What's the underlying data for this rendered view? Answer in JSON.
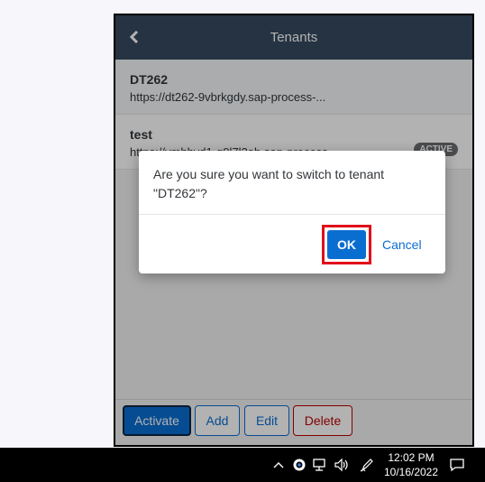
{
  "app": {
    "title": "Tenants",
    "back_icon": "chevron-left-icon"
  },
  "tenants": [
    {
      "name": "DT262",
      "url": "https://dt262-9vbrkgdy.sap-process-...",
      "badge": ""
    },
    {
      "name": "test",
      "url": "https://vmhhvd1-g9l7l3ab.sap-process-...",
      "badge": "ACTIVE"
    }
  ],
  "footer": {
    "activate_label": "Activate",
    "add_label": "Add",
    "edit_label": "Edit",
    "delete_label": "Delete"
  },
  "dialog": {
    "message": "Are you sure you want to switch to tenant \"DT262\"?",
    "ok_label": "OK",
    "cancel_label": "Cancel"
  },
  "taskbar": {
    "time": "12:02 PM",
    "date": "10/16/2022",
    "icons": [
      "chevron-up-icon",
      "defender-icon",
      "network-icon",
      "volume-icon",
      "pen-icon",
      "notification-icon"
    ]
  },
  "colors": {
    "header": "#354a5f",
    "accent": "#0a6ed1",
    "delete": "#bb0000",
    "highlight": "#e0101a"
  }
}
